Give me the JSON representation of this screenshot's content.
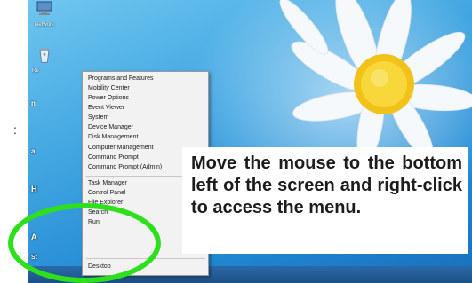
{
  "desktop": {
    "icons": [
      {
        "label": "Network",
        "icon": "network-icon"
      },
      {
        "label": "Re",
        "icon": "recycle-bin-icon"
      }
    ],
    "cut_letters": [
      "n",
      "a",
      "H",
      "A",
      "St"
    ],
    "left_mark": ":"
  },
  "menu": {
    "groups": [
      [
        "Programs and Features",
        "Mobility Center",
        "Power Options",
        "Event Viewer",
        "System",
        "Device Manager",
        "Disk Management",
        "Computer Management",
        "Command Prompt",
        "Command Prompt (Admin)"
      ],
      [
        "Task Manager",
        "Control Panel",
        "File Explorer",
        "Search",
        "Run"
      ],
      [
        "Desktop"
      ]
    ]
  },
  "callout": {
    "text": "Move the mouse to the bottom left of the screen and right-click to access the menu."
  },
  "colors": {
    "highlight": "#2ee01b",
    "sky": "#3fa4e0",
    "menu_bg": "#f2f2f2"
  }
}
